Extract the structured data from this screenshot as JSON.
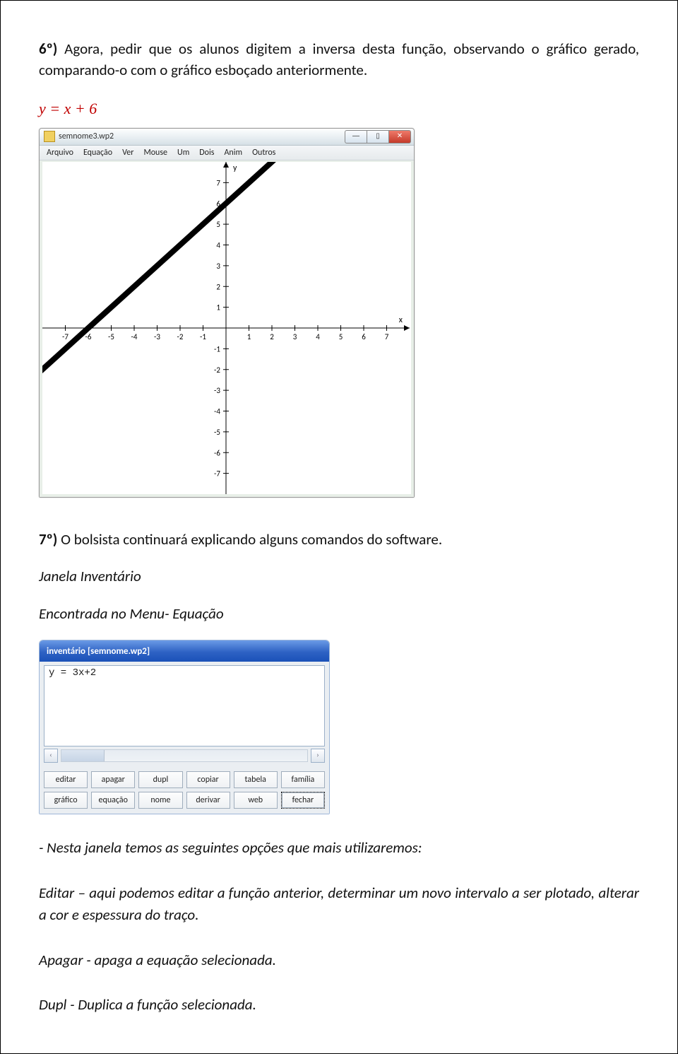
{
  "intro": {
    "bold": "6º)",
    "text": " Agora, pedir que os alunos digitem a inversa desta função, observando o gráfico gerado, comparando-o com o gráfico esboçado anteriormente."
  },
  "equation": "y = x + 6",
  "graph_window": {
    "title": "semnome3.wp2",
    "menus": [
      "Arquivo",
      "Equação",
      "Ver",
      "Mouse",
      "Um",
      "Dois",
      "Anim",
      "Outros"
    ],
    "win_btns": {
      "min": "—",
      "max": "▯",
      "close": "✕"
    }
  },
  "chart_data": {
    "type": "line",
    "title": "",
    "xlabel": "x",
    "ylabel": "y",
    "xlim": [
      -8,
      8
    ],
    "ylim": [
      -8,
      8
    ],
    "x_ticks": [
      -7,
      -6,
      -5,
      -4,
      -3,
      -2,
      -1,
      1,
      2,
      3,
      4,
      5,
      6,
      7
    ],
    "y_ticks": [
      -7,
      -6,
      -5,
      -4,
      -3,
      -2,
      -1,
      1,
      2,
      3,
      4,
      5,
      6,
      7
    ],
    "series": [
      {
        "name": "y = x + 6",
        "x": [
          -8,
          2
        ],
        "y": [
          -2,
          8
        ]
      }
    ]
  },
  "p7": {
    "bold": "7º)",
    "text": " O bolsista continuará explicando alguns comandos do software."
  },
  "sub1": "Janela Inventário",
  "sub2": "Encontrada no Menu- Equação",
  "inventory": {
    "title": "inventário [semnome.wp2]",
    "item": "y = 3x+2",
    "buttons_row1": [
      "editar",
      "apagar",
      "dupl",
      "copiar",
      "tabela",
      "família"
    ],
    "buttons_row2": [
      "gráfico",
      "equação",
      "nome",
      "derivar",
      "web",
      "fechar"
    ]
  },
  "p_opts": "- Nesta janela temos as seguintes opções que mais utilizaremos:",
  "p_editar": "Editar – aqui podemos editar a função anterior, determinar um novo intervalo a ser plotado, alterar a cor e espessura do traço.",
  "p_apagar": "Apagar - apaga a equação selecionada.",
  "p_dupl": "Dupl - Duplica a função selecionada."
}
